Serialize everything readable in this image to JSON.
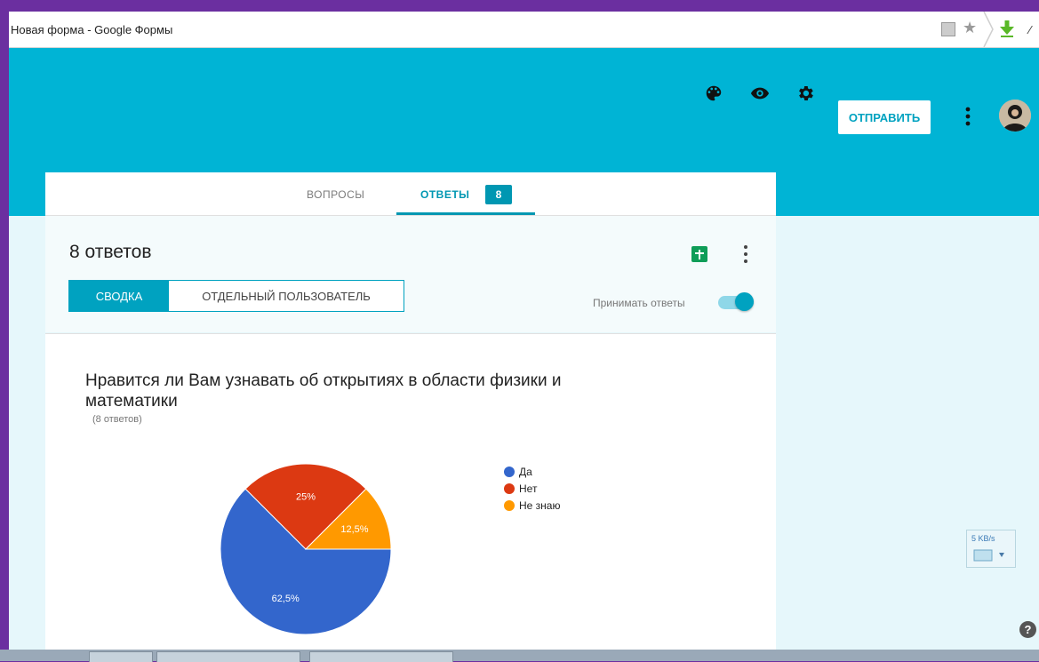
{
  "browser": {
    "tab_title": "Новая форма - Google Формы"
  },
  "header": {
    "send_label": "ОТПРАВИТЬ",
    "icons": [
      "palette-icon",
      "eye-icon",
      "gear-icon",
      "more-vert-icon",
      "avatar"
    ]
  },
  "tabs": {
    "questions": "ВОПРОСЫ",
    "answers": "ОТВЕТЫ",
    "answers_count": "8"
  },
  "summary": {
    "responses_title": "8 ответов",
    "view_summary": "СВОДКА",
    "view_individual": "ОТДЕЛЬНЫЙ ПОЛЬЗОВАТЕЛЬ",
    "accept_label": "Принимать ответы",
    "accepting": true
  },
  "question": {
    "title": "Нравится ли Вам узнавать об открытиях в области физики и математики",
    "responses": "(8 ответов)"
  },
  "chart_data": {
    "type": "pie",
    "categories": [
      "Да",
      "Нет",
      "Не знаю"
    ],
    "values": [
      62.5,
      25,
      12.5
    ],
    "labels": [
      "62,5%",
      "25%",
      "12,5%"
    ],
    "colors": [
      "#3366cc",
      "#dc3912",
      "#ff9900"
    ],
    "legend": "right"
  },
  "widgets": {
    "net_speed": "5 KB/s",
    "help": "?"
  },
  "colors": {
    "header": "#00b4d5",
    "accent": "#00a2c0",
    "frame": "#6b2fa0"
  }
}
